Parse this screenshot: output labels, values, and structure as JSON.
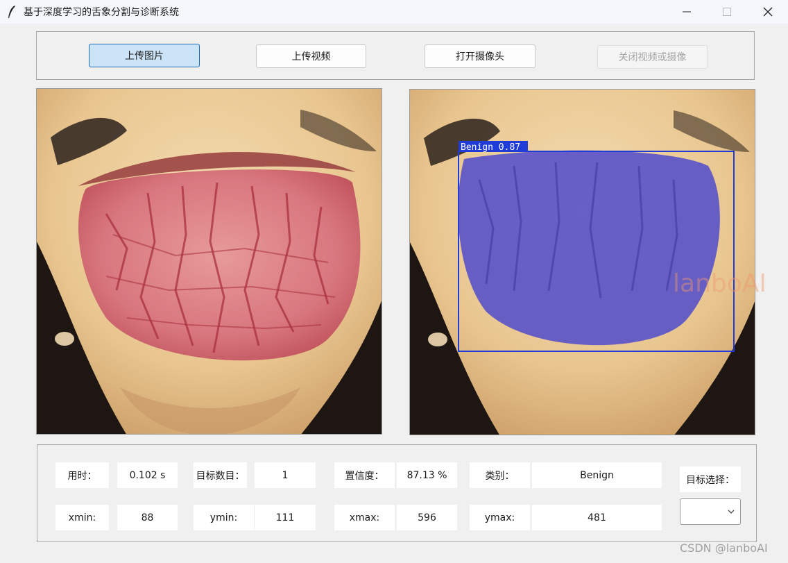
{
  "window": {
    "title": "基于深度学习的舌象分割与诊断系统",
    "controls": {
      "minimize_icon": "minimize-icon",
      "maximize_icon": "maximize-icon",
      "close_icon": "close-icon"
    }
  },
  "toolbar": {
    "upload_image": "上传图片",
    "upload_video": "上传视频",
    "open_camera": "打开摄像头",
    "close_video_camera": "关闭视频或摄像"
  },
  "detection": {
    "label": "Benign",
    "score": "0.87",
    "box_color": "#1f3bd8",
    "mask_color": "#5b55c8"
  },
  "watermark": "lanboAI",
  "info": {
    "time_label": "用时：",
    "time_value": "0.102 s",
    "count_label": "目标数目：",
    "count_value": "1",
    "conf_label": "置信度：",
    "conf_value": "87.13 %",
    "class_label": "类别：",
    "class_value": "Benign",
    "xmin_label": "xmin:",
    "xmin_value": "88",
    "ymin_label": "ymin:",
    "ymin_value": "111",
    "xmax_label": "xmax:",
    "xmax_value": "596",
    "ymax_label": "ymax:",
    "ymax_value": "481",
    "target_select_label": "目标选择：",
    "target_select_value": ""
  },
  "footer": {
    "csdn": "CSDN @lanboAI"
  }
}
